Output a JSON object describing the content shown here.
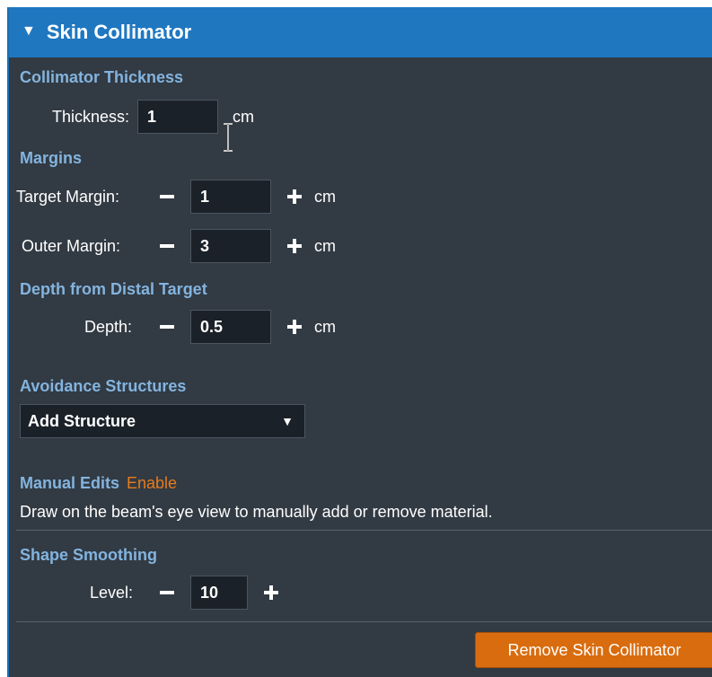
{
  "header": {
    "title": "Skin Collimator",
    "toggle_icon": "triangle-down-icon"
  },
  "thickness": {
    "section_title": "Collimator Thickness",
    "label": "Thickness:",
    "value": "1",
    "unit": "cm"
  },
  "margins": {
    "section_title": "Margins",
    "target": {
      "label": "Target Margin:",
      "value": "1",
      "unit": "cm"
    },
    "outer": {
      "label": "Outer Margin:",
      "value": "3",
      "unit": "cm"
    }
  },
  "depth": {
    "section_title": "Depth from Distal Target",
    "label": "Depth:",
    "value": "0.5",
    "unit": "cm"
  },
  "avoidance": {
    "section_title": "Avoidance Structures",
    "select_value": "Add Structure"
  },
  "manual_edits": {
    "section_title": "Manual Edits",
    "enable_label": "Enable",
    "note": "Draw on the beam's eye view to manually add or remove material."
  },
  "smoothing": {
    "section_title": "Shape Smoothing",
    "label": "Level:",
    "value": "10"
  },
  "footer": {
    "remove_label": "Remove Skin Collimator"
  },
  "colors": {
    "header_bg": "#1f77c0",
    "panel_bg": "#323a43",
    "section_title": "#83b4df",
    "accent_orange": "#d96c0e"
  }
}
